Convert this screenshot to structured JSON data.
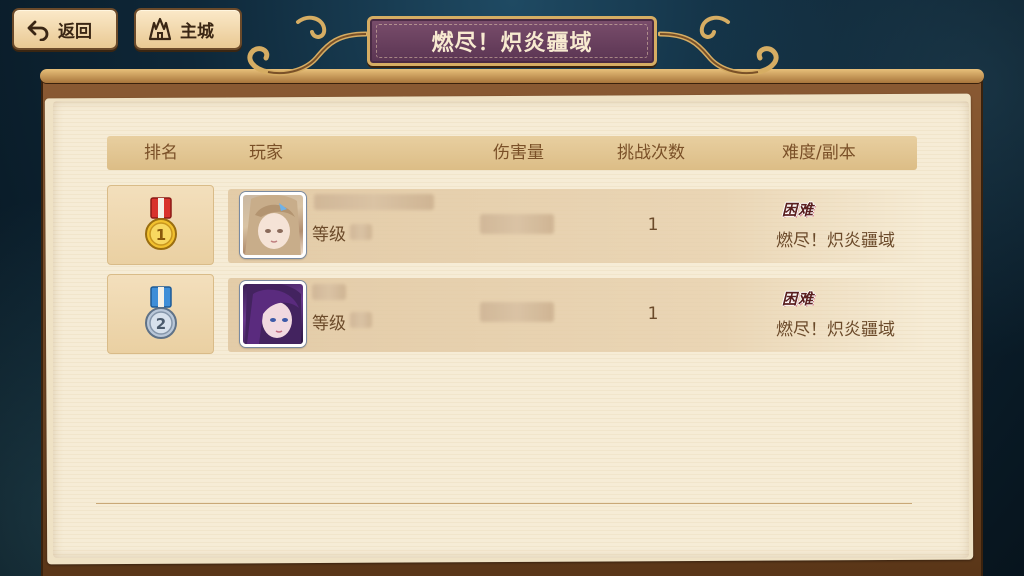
{
  "nav": {
    "back_label": "返回",
    "city_label": "主城"
  },
  "title": "燃尽！炽炎疆域",
  "table": {
    "headers": {
      "rank": "排名",
      "player": "玩家",
      "damage": "伤害量",
      "tries": "挑战次数",
      "difficulty": "难度/副本"
    },
    "rows": [
      {
        "rank": "1",
        "medal_color": "#f2c12e",
        "ribbon_color": "#d8322d",
        "level_label": "等级",
        "tries": "1",
        "difficulty": "困难",
        "stage": "燃尽！炽炎疆域"
      },
      {
        "rank": "2",
        "medal_color": "#b9c7d8",
        "ribbon_color": "#3e8ed8",
        "level_label": "等级",
        "tries": "1",
        "difficulty": "困难",
        "stage": "燃尽！炽炎疆域"
      }
    ]
  }
}
